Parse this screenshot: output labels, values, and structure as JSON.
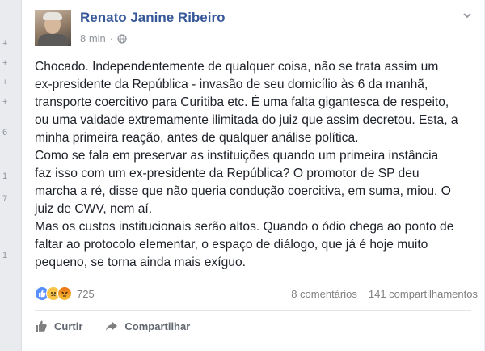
{
  "side_glyphs": [
    "+",
    "+",
    "+",
    "+",
    "6",
    "1",
    "7",
    "1"
  ],
  "post": {
    "author": "Renato Janine Ribeiro",
    "time": "8 min",
    "paragraphs": [
      "Chocado. Independentemente de qualquer coisa, não se trata assim um",
      "ex-presidente da República - invasão de seu domicílio às 6 da manhã,",
      "transporte coercitivo para Curitiba etc. É uma falta gigantesca de respeito,",
      "ou uma vaidade extremamente ilimitada do juiz que assim decretou. Esta, a",
      "minha primeira reação, antes de qualquer análise política.",
      "Como se fala em preservar as instituições quando um primeira instância",
      "faz isso com um ex-presidente da República? O promotor de SP deu",
      "marcha a ré, disse que não queria condução coercitiva, em suma, miou. O",
      "juiz de CWV, nem aí.",
      "Mas os custos institucionais serão altos. Quando o ódio chega ao ponto de",
      "faltar ao protocolo elementar, o espaço de diálogo, que já é hoje muito",
      "pequeno, se torna ainda mais exíguo."
    ]
  },
  "summary": {
    "reaction_count": "725",
    "comments": "8 comentários",
    "shares": "141 compartilhamentos"
  },
  "actions": {
    "like": "Curtir",
    "share": "Compartilhar"
  },
  "colors": {
    "author": "#365899",
    "muted": "#90949c",
    "like_blue": "#5890ff"
  },
  "icons": [
    "globe-icon",
    "chevron-down-icon",
    "like-icon",
    "share-icon",
    "like-reaction-icon",
    "sad-reaction-icon",
    "angry-reaction-icon"
  ]
}
